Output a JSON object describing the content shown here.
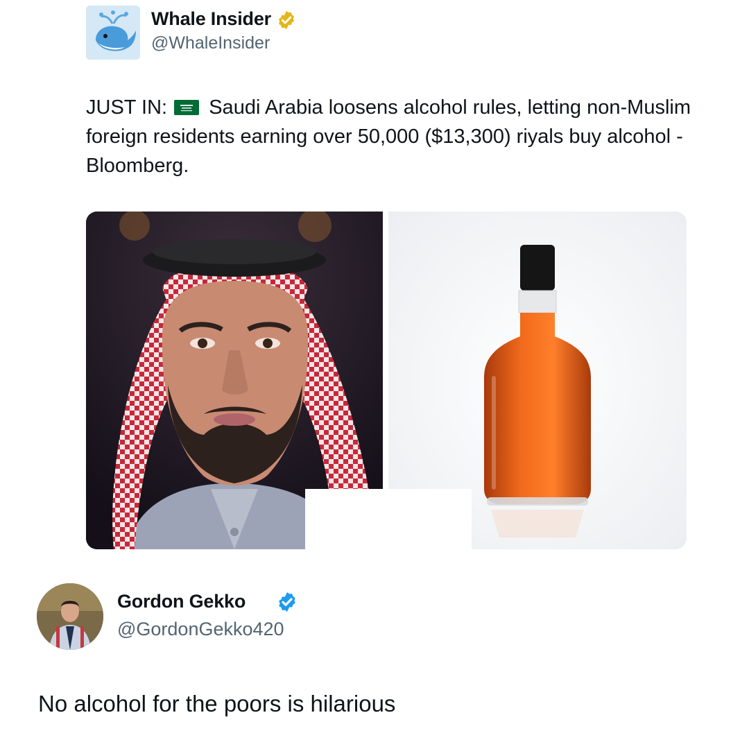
{
  "tweet": {
    "author": {
      "name": "Whale Insider",
      "handle": "@WhaleInsider",
      "verified_badge": "gold-check-badge",
      "avatar": "whale-logo"
    },
    "text_prefix": "JUST IN:",
    "flag": "saudi-arabia-flag",
    "text_body": "Saudi Arabia loosens alcohol rules, letting non-Muslim foreign residents earning over 50,000 ($13,300) riyals buy alcohol - Bloomberg.",
    "media": [
      {
        "kind": "photo",
        "subject": "man-in-red-keffiyeh-portrait"
      },
      {
        "kind": "photo",
        "subject": "liquor-bottle"
      }
    ]
  },
  "reply": {
    "author": {
      "name": "Gordon Gekko",
      "handle": "@GordonGekko420",
      "verified_badge": "blue-check-badge",
      "avatar": "man-in-suit-avatar"
    },
    "text": "No alcohol for the poors is hilarious"
  },
  "colors": {
    "text": "#0f1419",
    "handle": "#536471",
    "gold_badge": "#e2b719",
    "blue_badge": "#1d9bf0",
    "flag_green": "#006c35"
  }
}
